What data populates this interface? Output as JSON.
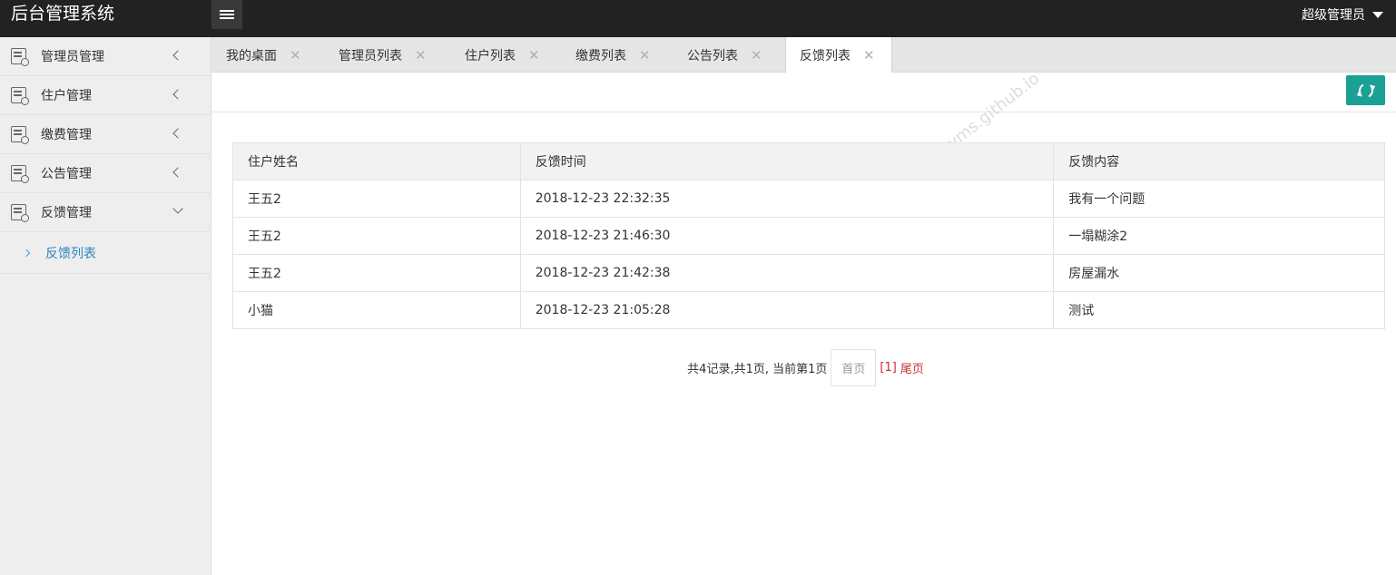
{
  "app": {
    "title": "后台管理系统",
    "user": "超级管理员"
  },
  "sidebar": {
    "items": [
      {
        "label": "管理员管理"
      },
      {
        "label": "住户管理"
      },
      {
        "label": "缴费管理"
      },
      {
        "label": "公告管理"
      },
      {
        "label": "反馈管理"
      }
    ],
    "sub_items": [
      {
        "label": "反馈列表"
      }
    ]
  },
  "tabs": [
    {
      "label": "我的桌面"
    },
    {
      "label": "管理员列表"
    },
    {
      "label": "住户列表"
    },
    {
      "label": "缴费列表"
    },
    {
      "label": "公告列表"
    },
    {
      "label": "反馈列表",
      "active": true
    }
  ],
  "table": {
    "headers": [
      "住户姓名",
      "反馈时间",
      "反馈内容"
    ],
    "rows": [
      [
        "王五2",
        "2018-12-23 22:32:35",
        "我有一个问题"
      ],
      [
        "王五2",
        "2018-12-23 21:46:30",
        "一塌糊涂2"
      ],
      [
        "王五2",
        "2018-12-23 21:42:38",
        "房屋漏水"
      ],
      [
        "小猫",
        "2018-12-23 21:05:28",
        "测试"
      ]
    ]
  },
  "pager": {
    "info": "共4记录,共1页, 当前第1页",
    "first": "首页",
    "page": "[1]",
    "last": "尾页"
  },
  "watermark": "javayms.github.io",
  "colors": {
    "header_bg": "#222222",
    "accent": "#1aa094",
    "link": "#2e86c1",
    "pager_red": "#c9302c"
  }
}
